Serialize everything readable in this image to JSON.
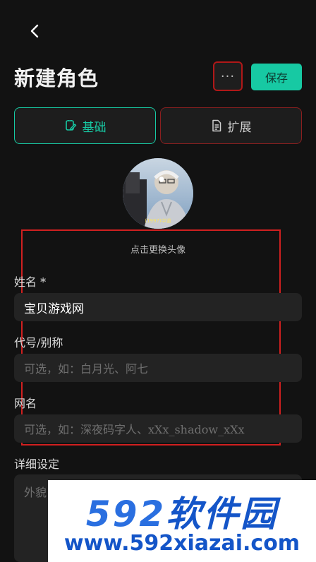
{
  "header": {
    "title": "新建角色",
    "more_label": "···",
    "save_label": "保存"
  },
  "tabs": [
    {
      "label": "基础",
      "icon": "edit-note-icon",
      "active": true
    },
    {
      "label": "扩展",
      "icon": "document-icon",
      "active": false
    }
  ],
  "avatar": {
    "caption": "点击更换头像",
    "subtitle_text": "(1997)中道"
  },
  "form": {
    "name": {
      "label": "姓名 *",
      "value": "宝贝游戏网"
    },
    "alias": {
      "label": "代号/别称",
      "placeholder": "可选，如：白月光、阿七"
    },
    "net_name": {
      "label": "网名",
      "placeholder": "可选，如：深夜码字人、xXx_shadow_xXx"
    },
    "details": {
      "label": "详细设定",
      "placeholder": "外貌"
    }
  },
  "watermark": {
    "brand_num": "592",
    "brand_cn": "软件园",
    "url": "www.592xiazai.com"
  },
  "colors": {
    "accent": "#17c9a3",
    "highlight": "#d02020",
    "background": "#121212"
  }
}
